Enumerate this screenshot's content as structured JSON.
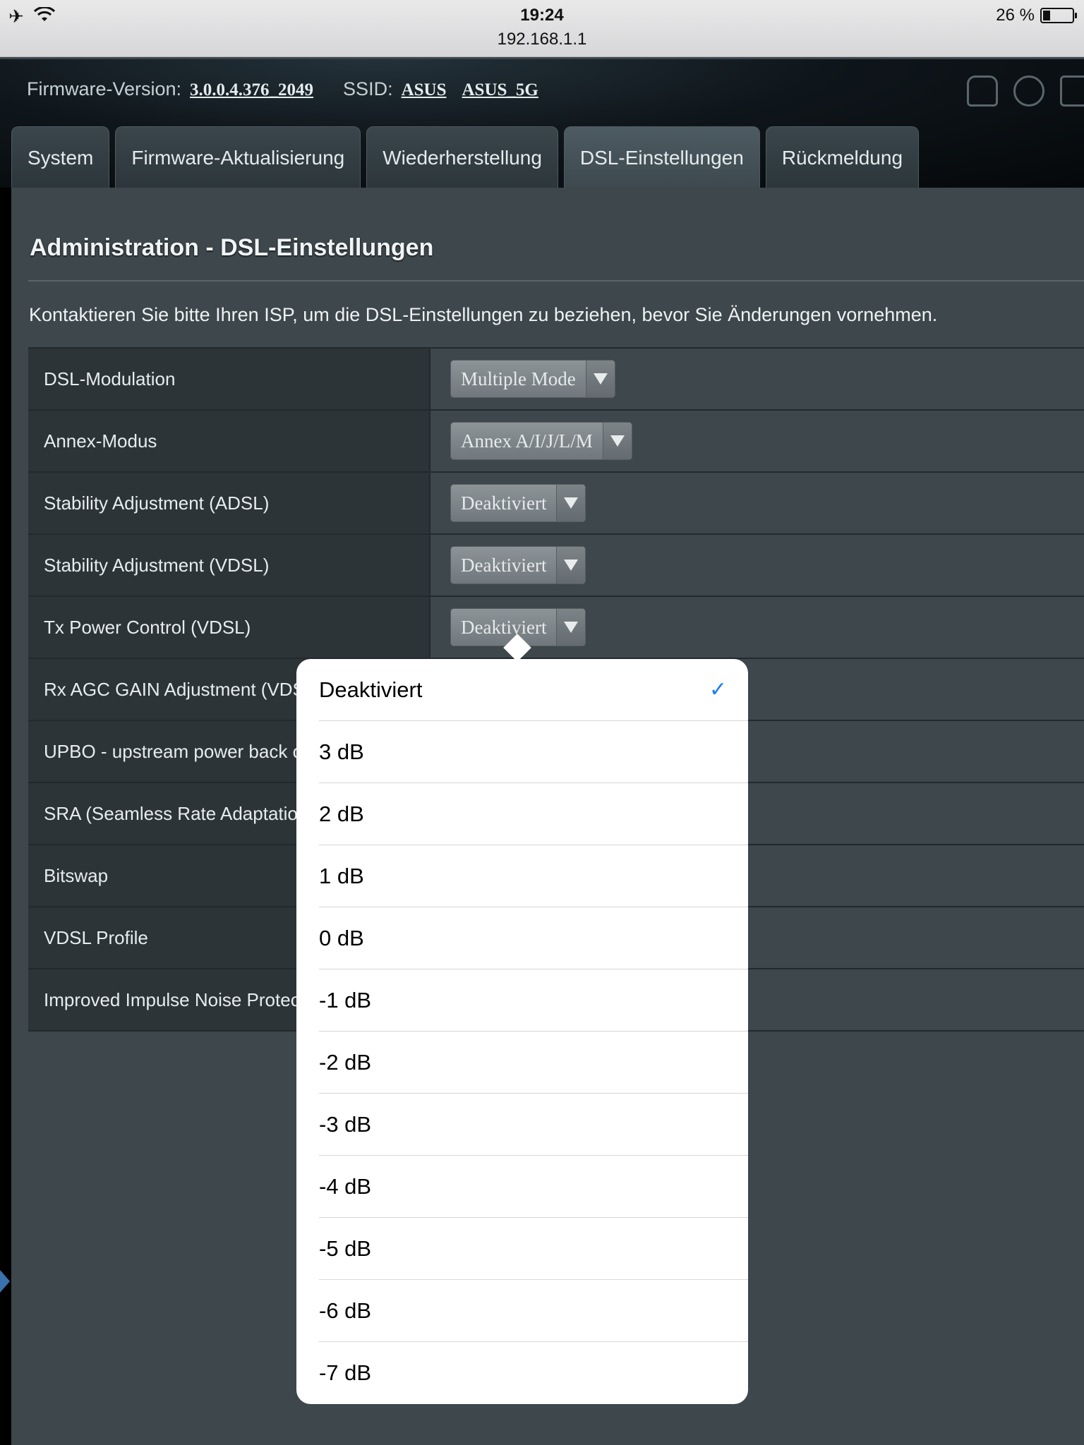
{
  "status_bar": {
    "airplane_icon": "airplane-icon",
    "wifi_icon": "wifi-icon",
    "time": "19:24",
    "url": "192.168.1.1",
    "battery_text": "26 %",
    "battery_level": 0.26
  },
  "header": {
    "firmware_label": "Firmware-Version:",
    "firmware_version": "3.0.0.4.376_2049",
    "ssid_label": "SSID:",
    "ssid_1": "ASUS",
    "ssid_2": "ASUS_5G",
    "icons": [
      "people-icon",
      "globe-icon",
      "monitor-icon"
    ]
  },
  "tabs": [
    {
      "label": "System",
      "active": false
    },
    {
      "label": "Firmware-Aktualisierung",
      "active": false
    },
    {
      "label": "Wiederherstellung",
      "active": false
    },
    {
      "label": "DSL-Einstellungen",
      "active": true
    },
    {
      "label": "Rückmeldung",
      "active": false
    }
  ],
  "page": {
    "title": "Administration - DSL-Einstellungen",
    "description": "Kontaktieren Sie bitte Ihren ISP, um die DSL-Einstellungen zu beziehen, bevor Sie Änderungen vornehmen."
  },
  "settings": [
    {
      "label": "DSL-Modulation",
      "value": "Multiple Mode"
    },
    {
      "label": "Annex-Modus",
      "value": "Annex A/I/J/L/M"
    },
    {
      "label": "Stability Adjustment (ADSL)",
      "value": "Deaktiviert"
    },
    {
      "label": "Stability Adjustment (VDSL)",
      "value": "Deaktiviert"
    },
    {
      "label": "Tx Power Control (VDSL)",
      "value": "Deaktiviert"
    },
    {
      "label": "Rx AGC GAIN Adjustment (VDSL)",
      "value": ""
    },
    {
      "label": "UPBO - upstream power back off",
      "value": ""
    },
    {
      "label": "SRA (Seamless Rate Adaptation)",
      "value": ""
    },
    {
      "label": "Bitswap",
      "value": ""
    },
    {
      "label": "VDSL Profile",
      "value": ""
    },
    {
      "label": "Improved Impulse Noise Protection",
      "value": ""
    }
  ],
  "popover": {
    "selected": "Deaktiviert",
    "options": [
      "Deaktiviert",
      "3 dB",
      "2 dB",
      "1 dB",
      "0 dB",
      "-1 dB",
      "-2 dB",
      "-3 dB",
      "-4 dB",
      "-5 dB",
      "-6 dB",
      "-7 dB"
    ],
    "check_icon": "checkmark-icon",
    "check_glyph": "✓",
    "check_color": "#1a7ef2"
  }
}
